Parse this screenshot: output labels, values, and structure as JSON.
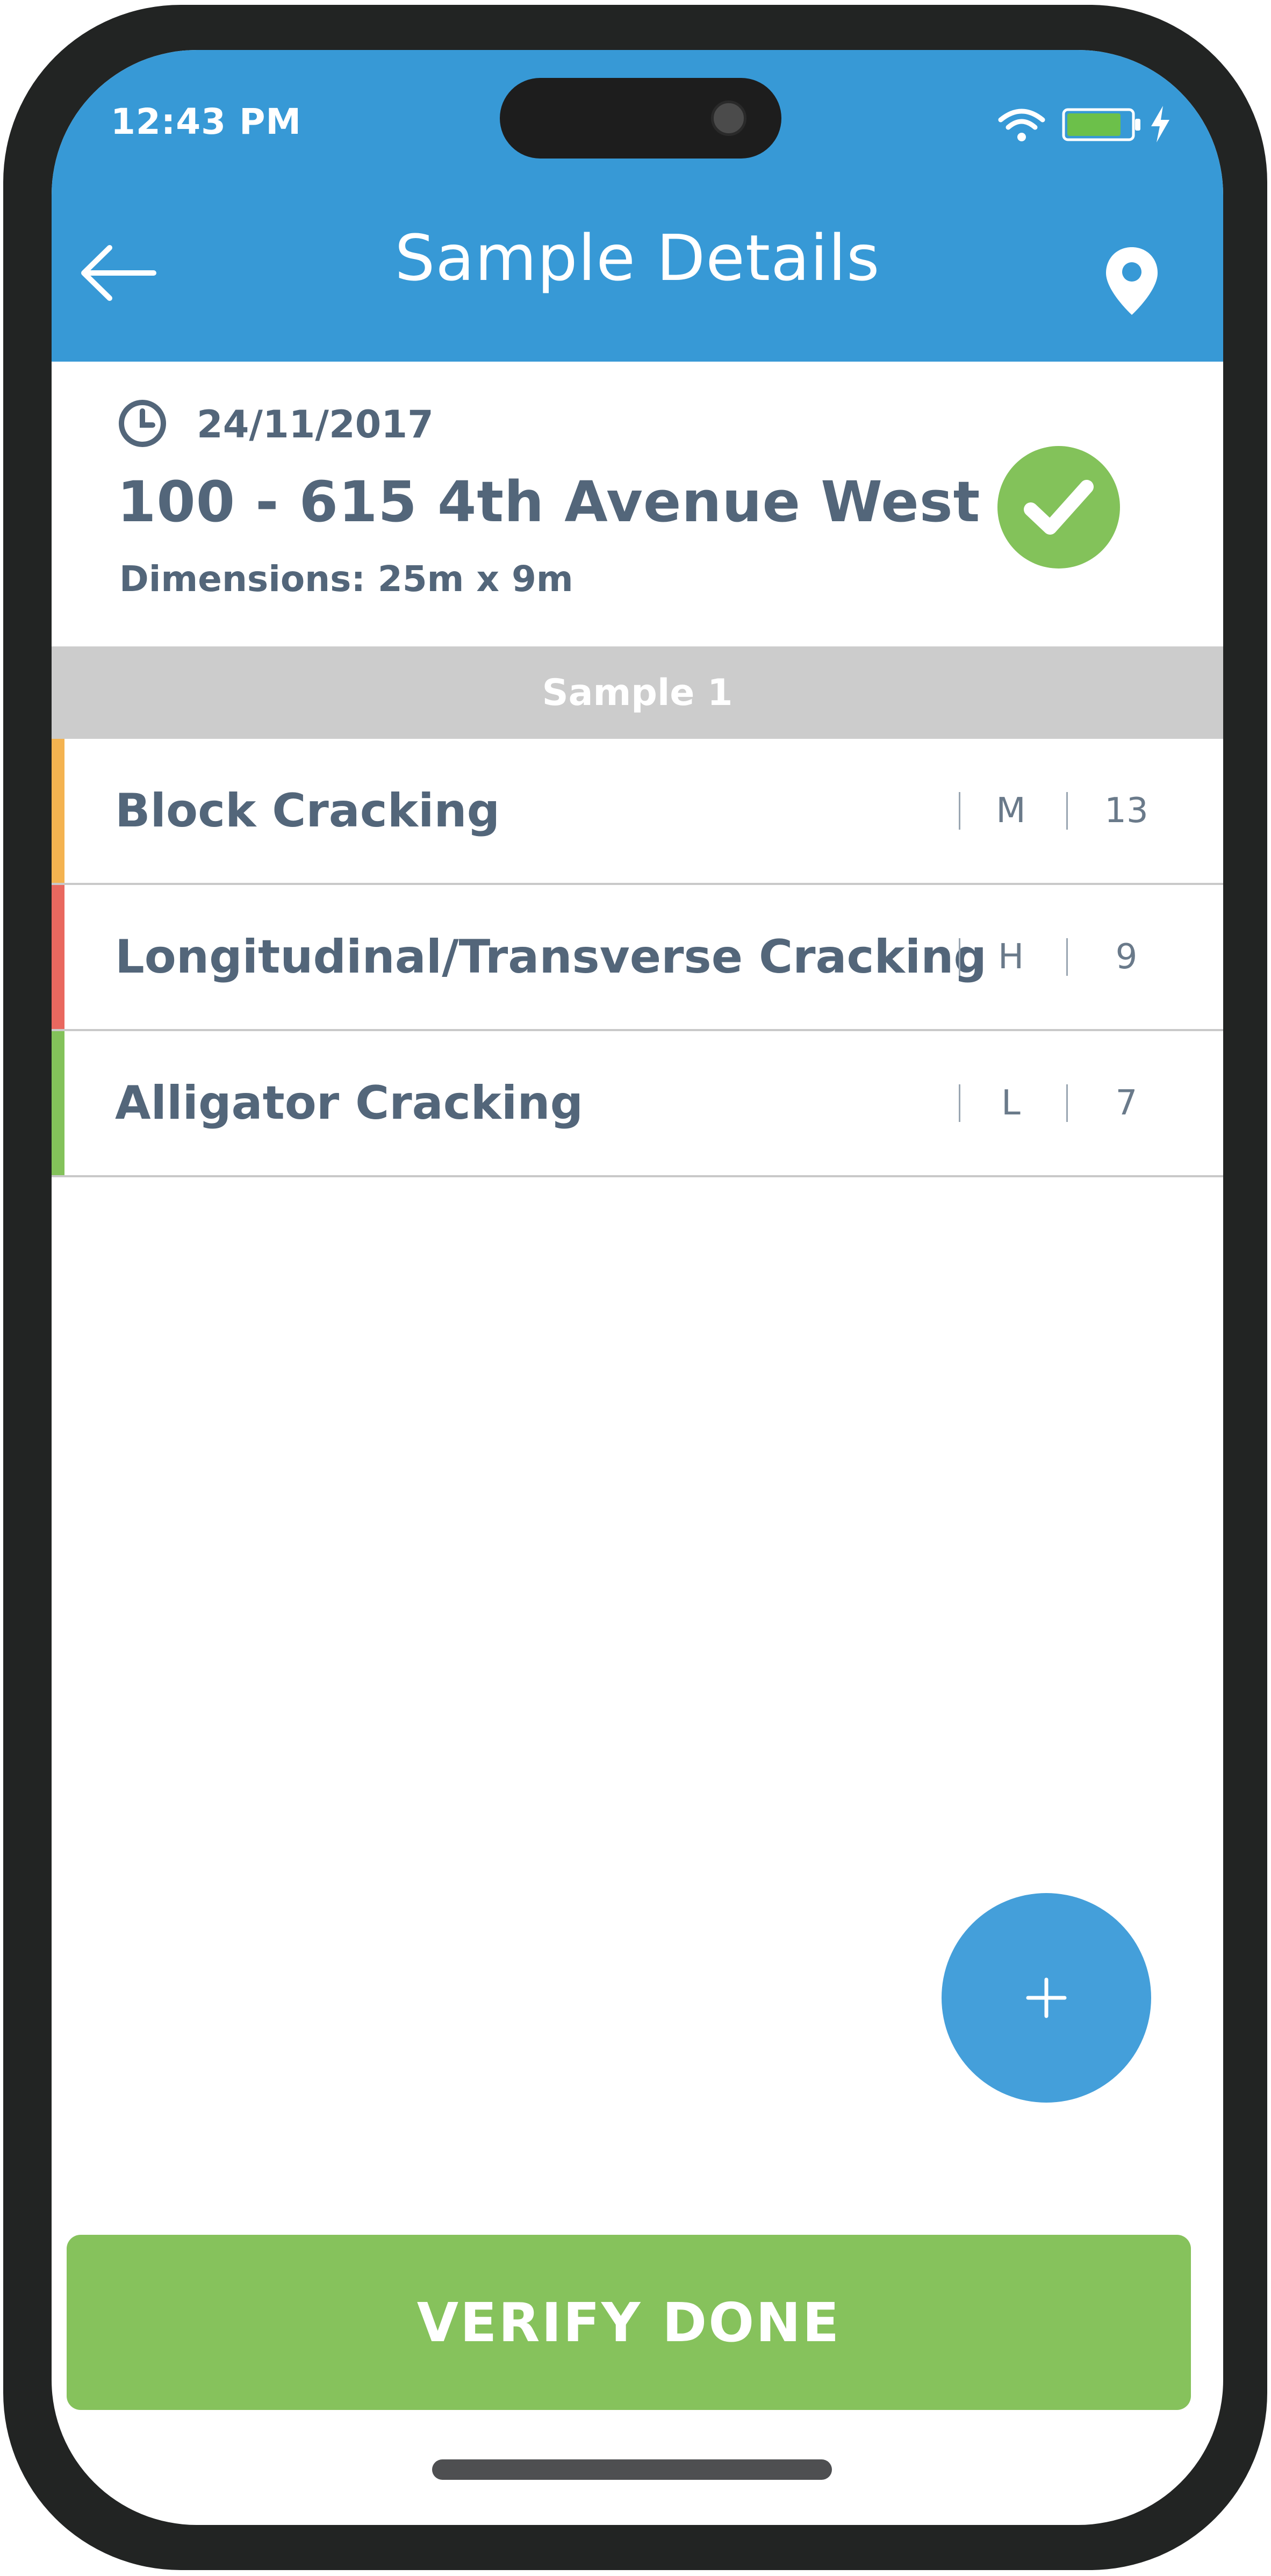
{
  "status_bar": {
    "time": "12:43 PM",
    "wifi_icon": "wifi-icon",
    "battery_icon": "battery-charging-icon",
    "battery_level": 0.85
  },
  "header": {
    "title": "Sample Details",
    "back_icon": "arrow-left-icon",
    "location_icon": "map-pin-icon",
    "background_color": "#3799d6"
  },
  "info": {
    "date": "24/11/2017",
    "date_icon": "clock-icon",
    "address": "100 - 615 4th Avenue West",
    "dimensions": "Dimensions: 25m x 9m",
    "status_icon": "check-circle-icon",
    "status_color": "#83c25a"
  },
  "section": {
    "label": "Sample 1"
  },
  "distresses": [
    {
      "name": "Block Cracking",
      "severity": "M",
      "quantity": "13",
      "color": "#f4b350"
    },
    {
      "name": "Longitudinal/Transverse Cracking",
      "severity": "H",
      "quantity": "9",
      "color": "#e9685f"
    },
    {
      "name": "Alligator Cracking",
      "severity": "L",
      "quantity": "7",
      "color": "#83c25a"
    }
  ],
  "fab": {
    "label": "+",
    "icon": "plus-icon"
  },
  "verify_button": {
    "label": "VERIFY DONE",
    "color": "#86c25c"
  }
}
